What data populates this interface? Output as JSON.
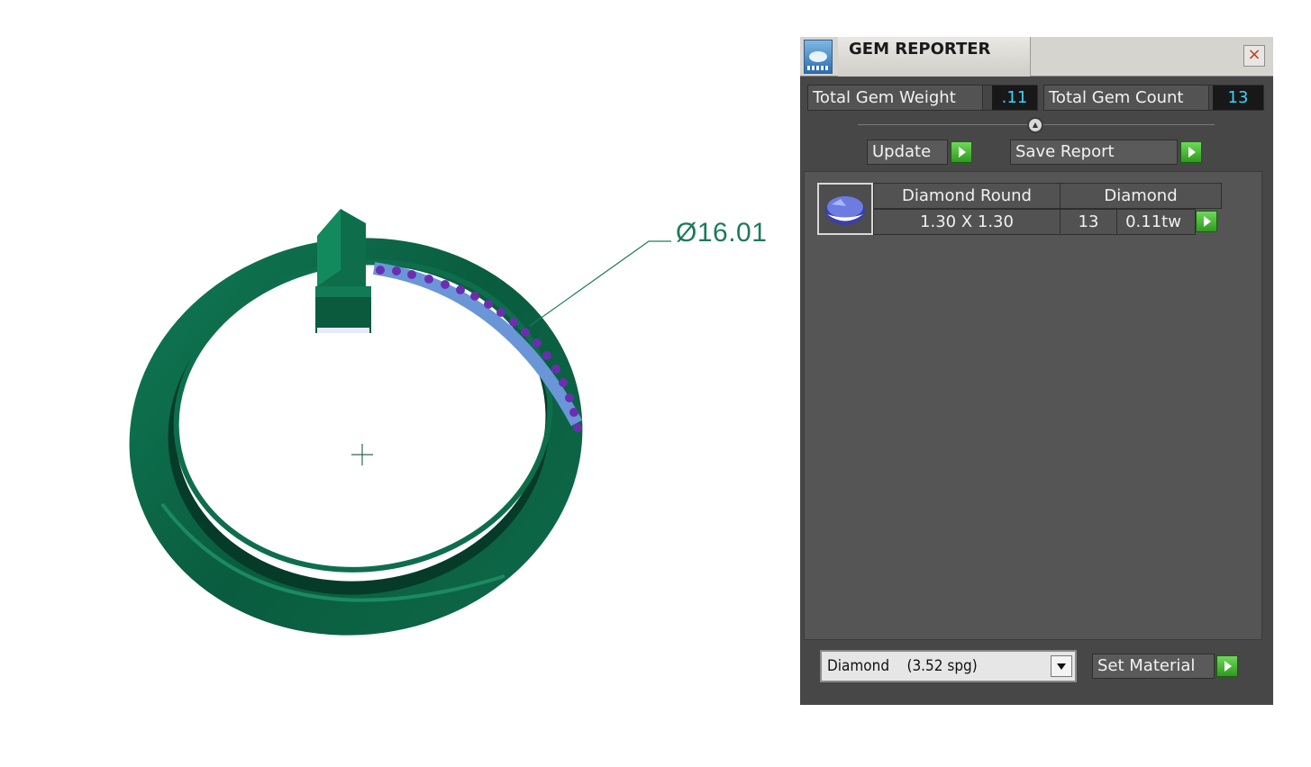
{
  "viewport": {
    "dimension_label": "Ø16.01"
  },
  "panel": {
    "title": "GEM REPORTER",
    "close_label": "×",
    "total_weight_label": "Total Gem Weight",
    "total_weight_value": ".11",
    "total_count_label": "Total Gem Count",
    "total_count_value": "13",
    "update_label": "Update",
    "save_report_label": "Save Report",
    "gems": [
      {
        "shape": "Diamond Round",
        "material": "Diamond",
        "size": "1.30 X 1.30",
        "count": "13",
        "weight": "0.11tw"
      }
    ],
    "material_select": {
      "value": "Diamond    (3.52 spg)"
    },
    "set_material_label": "Set Material"
  },
  "colors": {
    "ring_green": "#0f6b4a",
    "gem_purple": "#6a2fb0",
    "value_cyan": "#3fd3ff",
    "go_green": "#3fae2a"
  }
}
